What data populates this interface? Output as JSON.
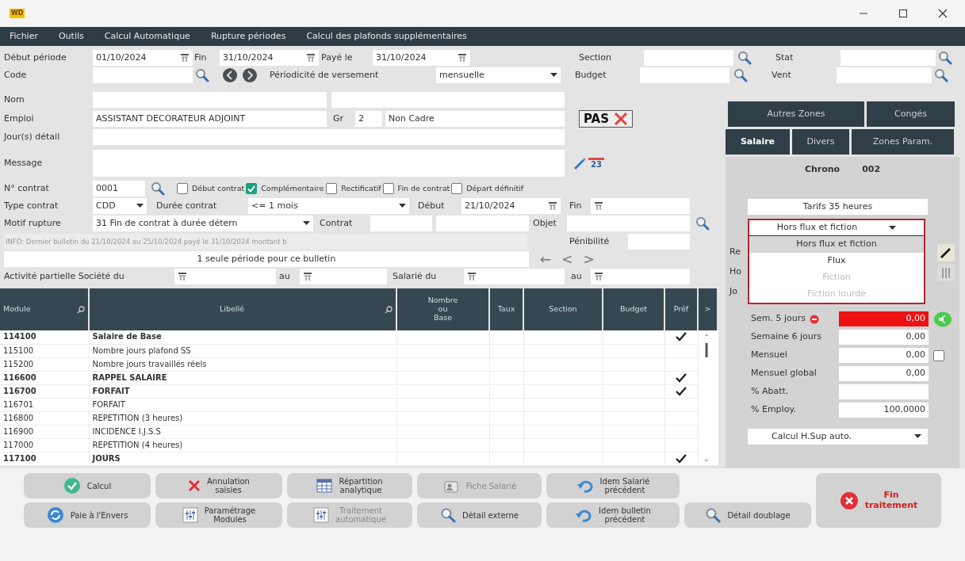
{
  "app_logo": "WD",
  "menu": [
    "Fichier",
    "Outils",
    "Calcul Automatique",
    "Rupture périodes",
    "Calcul des plafonds supplémentaires"
  ],
  "form_rows": [
    {
      "items": [
        {
          "kind": "label",
          "text": "Début période"
        },
        {
          "kind": "date",
          "value": "01/10/2024"
        },
        {
          "kind": "label",
          "text": "Fin"
        },
        {
          "kind": "date",
          "value": "31/10/2024"
        },
        {
          "kind": "label",
          "text": "Payé le"
        },
        {
          "kind": "date",
          "value": "31/10/2024"
        },
        {
          "kind": "label",
          "text": "Section"
        },
        {
          "kind": "field"
        },
        {
          "kind": "search"
        },
        {
          "kind": "label",
          "text": "Stat"
        },
        {
          "kind": "field"
        },
        {
          "kind": "search"
        }
      ]
    },
    {
      "items": [
        {
          "kind": "label",
          "text": "Code"
        },
        {
          "kind": "field"
        },
        {
          "kind": "search"
        },
        {
          "kind": "nav"
        },
        {
          "kind": "label",
          "text": "Périodicité de versement"
        },
        {
          "kind": "select",
          "value": "mensuelle"
        },
        {
          "kind": "label",
          "text": "Budget"
        },
        {
          "kind": "field"
        },
        {
          "kind": "search"
        },
        {
          "kind": "label",
          "text": "Vent"
        },
        {
          "kind": "field"
        },
        {
          "kind": "search"
        }
      ]
    },
    {
      "items": [
        {
          "kind": "label",
          "text": "Nom"
        },
        {
          "kind": "field"
        },
        {
          "kind": "field"
        }
      ]
    },
    {
      "items": [
        {
          "kind": "label",
          "text": "Emploi"
        },
        {
          "kind": "field",
          "value": "ASSISTANT DECORATEUR ADJOINT"
        },
        {
          "kind": "label",
          "text": "Gr"
        },
        {
          "kind": "field",
          "value": "2"
        },
        {
          "kind": "field",
          "value": "Non Cadre"
        },
        {
          "kind": "pas",
          "text": "PAS"
        }
      ]
    },
    {
      "items": [
        {
          "kind": "label",
          "text": "Jour(s) détail"
        },
        {
          "kind": "field"
        }
      ]
    },
    {
      "items": [
        {
          "kind": "label",
          "text": "Message"
        },
        {
          "kind": "field"
        },
        {
          "kind": "cal_edit",
          "text": "23"
        }
      ]
    },
    {
      "items": [
        {
          "kind": "label",
          "text": "N° contrat"
        },
        {
          "kind": "field",
          "value": "0001"
        },
        {
          "kind": "search"
        },
        {
          "kind": "check",
          "label": "Début contrat",
          "checked": false
        },
        {
          "kind": "check",
          "label": "Complémentaire",
          "checked": true
        },
        {
          "kind": "check",
          "label": "Rectificatif",
          "checked": false
        },
        {
          "kind": "check",
          "label": "Fin de contrat",
          "checked": false
        },
        {
          "kind": "check",
          "label": "Départ définitif",
          "checked": false
        }
      ]
    },
    {
      "items": [
        {
          "kind": "label",
          "text": "Type contrat"
        },
        {
          "kind": "select",
          "value": "CDD"
        },
        {
          "kind": "label",
          "text": "Durée contrat"
        },
        {
          "kind": "select",
          "value": "<= 1 mois"
        },
        {
          "kind": "label",
          "text": "Début"
        },
        {
          "kind": "date",
          "value": "21/10/2024"
        },
        {
          "kind": "label",
          "text": "Fin"
        },
        {
          "kind": "date"
        }
      ]
    },
    {
      "items": [
        {
          "kind": "label",
          "text": "Motif rupture"
        },
        {
          "kind": "select",
          "value": "31 Fin de contrat à durée détern"
        },
        {
          "kind": "label",
          "text": "Contrat"
        },
        {
          "kind": "field"
        },
        {
          "kind": "field"
        },
        {
          "kind": "label",
          "text": "Objet"
        },
        {
          "kind": "field"
        },
        {
          "kind": "search"
        }
      ]
    },
    {
      "items": [
        {
          "kind": "info",
          "text": "INFO: Dernier bulletin du 21/10/2024 au 25/10/2024 payé le 31/10/2024 montant b"
        },
        {
          "kind": "label",
          "text": "Pénibilité"
        },
        {
          "kind": "field"
        }
      ]
    },
    {
      "items": [
        {
          "kind": "banner",
          "text": "1 seule période pour ce bulletin"
        },
        {
          "kind": "arrows",
          "chars": [
            "←",
            "<",
            ">"
          ]
        }
      ]
    },
    {
      "items": [
        {
          "kind": "label",
          "text": "Activité partielle Société du"
        },
        {
          "kind": "date"
        },
        {
          "kind": "label",
          "text": "au"
        },
        {
          "kind": "date"
        },
        {
          "kind": "label",
          "text": "Salarié du"
        },
        {
          "kind": "date"
        },
        {
          "kind": "label",
          "text": "au"
        },
        {
          "kind": "date"
        }
      ]
    }
  ],
  "table": {
    "columns": [
      "Module",
      "Libellé",
      "Nombre\nou\nBase",
      "Taux",
      "Section",
      "Budget",
      "Préf",
      ">"
    ],
    "rows": [
      {
        "module": "114100",
        "label": "Salaire de Base",
        "bold": true,
        "pref": true
      },
      {
        "module": "115100",
        "label": "Nombre jours plafond SS",
        "bold": false,
        "pref": false
      },
      {
        "module": "115200",
        "label": "Nombre jours travaillés réels",
        "bold": false,
        "pref": false
      },
      {
        "module": "116600",
        "label": "RAPPEL SALAIRE",
        "bold": true,
        "pref": true
      },
      {
        "module": "116700",
        "label": "FORFAIT",
        "bold": true,
        "pref": true
      },
      {
        "module": "116701",
        "label": "FORFAIT",
        "bold": false,
        "pref": false
      },
      {
        "module": "116800",
        "label": "REPETITION (3 heures)",
        "bold": false,
        "pref": false
      },
      {
        "module": "116900",
        "label": "INCIDENCE I.J.S.S",
        "bold": false,
        "pref": false
      },
      {
        "module": "117000",
        "label": "REPETITION (4 heures)",
        "bold": false,
        "pref": false
      },
      {
        "module": "117100",
        "label": "JOURS",
        "bold": true,
        "pref": true
      }
    ]
  },
  "tab_rows": [
    {
      "tabs": [
        {
          "label": "Autres Zones",
          "selected": false
        },
        {
          "label": "Congés",
          "selected": false
        }
      ]
    },
    {
      "tabs": [
        {
          "label": "Salaire",
          "selected": true
        },
        {
          "label": "Divers",
          "selected": false
        },
        {
          "label": "Zones Param.",
          "selected": false
        }
      ]
    }
  ],
  "chrono": {
    "label": "Chrono",
    "value": "002"
  },
  "tarif": "Tarifs 35 heures",
  "regime": {
    "value": "Hors flux et fiction",
    "options": [
      {
        "label": "Hors flux et fiction",
        "selected": true,
        "disabled": false
      },
      {
        "label": "Flux",
        "selected": false,
        "disabled": false
      },
      {
        "label": "Fiction",
        "selected": false,
        "disabled": true
      },
      {
        "label": "Fiction lourde",
        "selected": false,
        "disabled": true
      }
    ]
  },
  "hidden_labels": [
    "Re",
    "Ho",
    "Jo"
  ],
  "amounts": [
    {
      "label": "Sem. 5 jours",
      "value": "0,00",
      "kind": "alert"
    },
    {
      "label": "Semaine 6 jours",
      "value": "0,00",
      "kind": "plain"
    },
    {
      "label": "Mensuel",
      "value": "0,00",
      "kind": "check",
      "checked": false
    },
    {
      "label": "Mensuel global",
      "value": "0,00",
      "kind": "plain"
    },
    {
      "label": "% Abatt.",
      "kind": "plain"
    },
    {
      "label": "% Employ.",
      "value": "100,0000",
      "kind": "plain"
    }
  ],
  "hsup": "Calcul H.Sup auto.",
  "buttons": [
    {
      "label": "Calcul",
      "kind": "normal",
      "disabled": false
    },
    {
      "label": "Annulation\nsaisies",
      "kind": "normal",
      "disabled": false
    },
    {
      "label": "Répartition\nanalytique",
      "kind": "normal",
      "disabled": false
    },
    {
      "label": "Fiche Salarié",
      "kind": "normal",
      "disabled": true
    },
    {
      "label": "Idem Salarié\nprécédent",
      "kind": "normal",
      "disabled": false
    },
    {
      "label": "Fin\ntraitement",
      "kind": "exit",
      "disabled": false
    },
    {
      "label": "Paie à l'Envers",
      "kind": "normal",
      "disabled": false
    },
    {
      "label": "Paramétrage\nModules",
      "kind": "normal",
      "disabled": false
    },
    {
      "label": "Traitement\nautomatique",
      "kind": "normal",
      "disabled": true
    },
    {
      "label": "Détail externe",
      "kind": "normal",
      "disabled": false
    },
    {
      "label": "Idem bulletin\nprécédent",
      "kind": "normal",
      "disabled": false
    },
    {
      "label": "Détail doublage",
      "kind": "normal",
      "disabled": false
    }
  ]
}
